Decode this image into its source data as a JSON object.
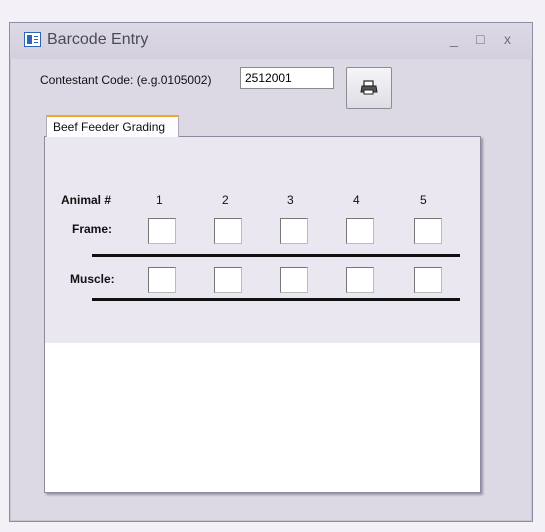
{
  "window": {
    "title": "Barcode Entry",
    "minimize_glyph": "_",
    "maximize_glyph": "□",
    "close_glyph": "x"
  },
  "contestant": {
    "label": "Contestant Code: (e.g.0105002)",
    "value": "2512001"
  },
  "print_button": {
    "icon": "printer-icon"
  },
  "tab": {
    "label": "Beef Feeder Grading"
  },
  "grading": {
    "animal_label": "Animal #",
    "frame_label": "Frame:",
    "muscle_label": "Muscle:",
    "animals": [
      "1",
      "2",
      "3",
      "4",
      "5"
    ]
  },
  "colors": {
    "window_bg": "#dcd8e4",
    "panel_bg": "#ebe7f0",
    "tab_accent": "#f2a52a"
  }
}
